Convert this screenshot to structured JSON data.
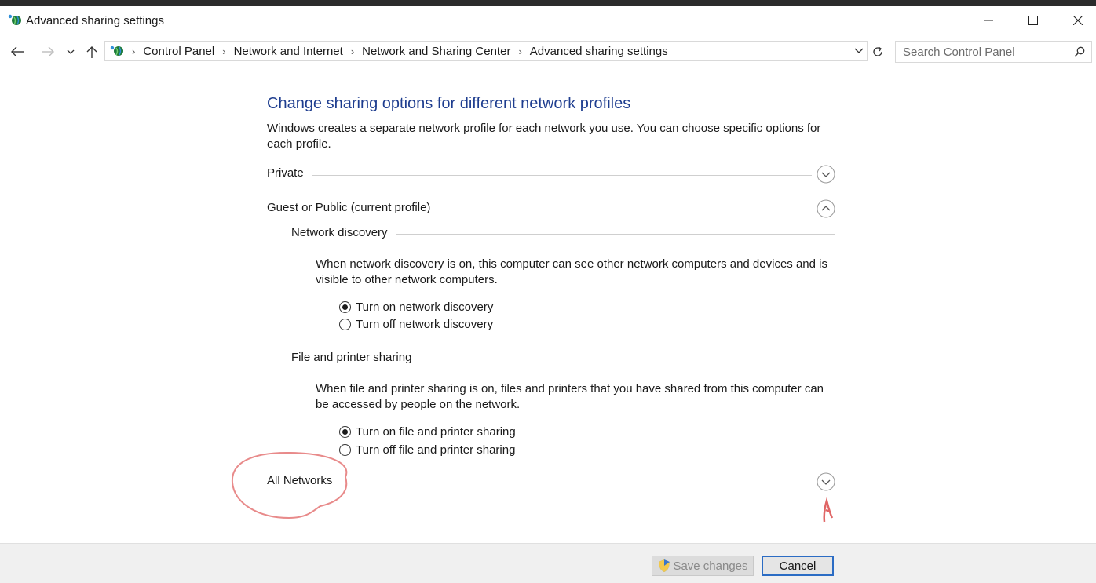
{
  "window": {
    "title": "Advanced sharing settings",
    "title_icon": "network-globe-icon"
  },
  "navigation": {
    "breadcrumbs": [
      "Control Panel",
      "Network and Internet",
      "Network and Sharing Center",
      "Advanced sharing settings"
    ],
    "search_placeholder": "Search Control Panel"
  },
  "main": {
    "heading": "Change sharing options for different network profiles",
    "description": "Windows creates a separate network profile for each network you use. You can choose specific options for each profile.",
    "profiles": {
      "private": {
        "label": "Private",
        "state": "collapsed"
      },
      "guest_public": {
        "label": "Guest or Public (current profile)",
        "state": "expanded",
        "network_discovery": {
          "label": "Network discovery",
          "description": "When network discovery is on, this computer can see other network computers and devices and is visible to other network computers.",
          "options": [
            "Turn on network discovery",
            "Turn off network discovery"
          ],
          "selected_index": 0
        },
        "file_printer_sharing": {
          "label": "File and printer sharing",
          "description": "When file and printer sharing is on, files and printers that you have shared from this computer can be accessed by people on the network.",
          "options": [
            "Turn on file and printer sharing",
            "Turn off file and printer sharing"
          ],
          "selected_index": 0
        }
      },
      "all_networks": {
        "label": "All Networks",
        "state": "collapsed"
      }
    }
  },
  "footer": {
    "save_label": "Save changes",
    "cancel_label": "Cancel"
  },
  "colors": {
    "heading": "#1e3d8f",
    "annotation": "#e88a8a",
    "cancel_border": "#2b6cc4"
  }
}
